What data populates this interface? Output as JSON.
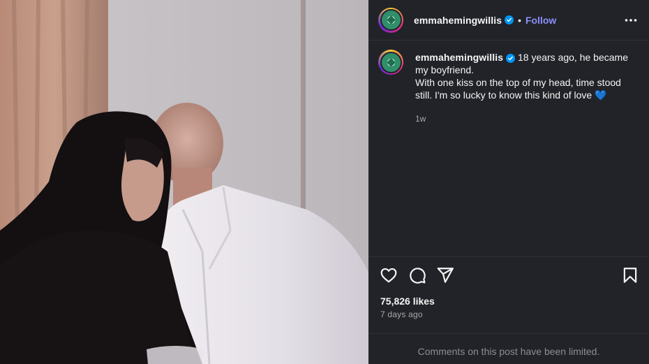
{
  "post": {
    "username": "emmahemingwillis",
    "verified": true,
    "follow_label": "Follow",
    "separator": "•",
    "caption_line1": "18 years ago, he became my boyfriend.",
    "caption_line2": "With one kiss on the top of my head, time stood still. I'm so lucky to know this kind of love 💙",
    "caption_time": "1w",
    "likes": "75,826 likes",
    "posted_ago": "7 days ago",
    "comments_notice": "Comments on this post have been limited."
  },
  "icons": {
    "more": "more-options-icon",
    "like": "heart-icon",
    "comment": "comment-icon",
    "share": "share-icon",
    "save": "bookmark-icon",
    "verified": "verified-badge-icon"
  },
  "colors": {
    "panel_bg": "#212328",
    "follow": "#8c8ff9",
    "verified": "#0095f6",
    "muted": "#a8a8a8"
  }
}
